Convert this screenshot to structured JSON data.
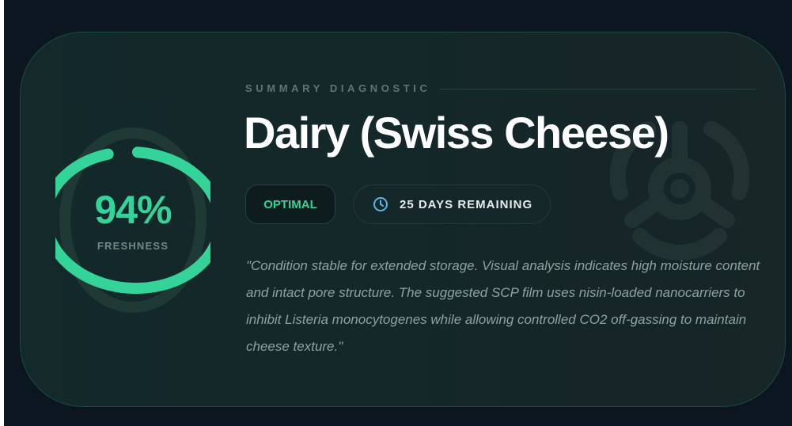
{
  "card": {
    "freshness": {
      "value": 0.94,
      "percent_label": "94%",
      "label": "FRESHNESS",
      "ring_color": "#34d399",
      "track_color": "#1f3a35"
    },
    "kicker": "SUMMARY DIAGNOSTIC",
    "title": "Dairy (Swiss Cheese)",
    "status_badge": "OPTIMAL",
    "remaining_badge": "25 DAYS REMAINING",
    "icons": {
      "clock": "clock-icon",
      "background": "biohazard-icon"
    },
    "description": "\"Condition stable for extended storage. Visual analysis indicates high moisture content and intact pore structure. The suggested SCP film uses nisin-loaded nanocarriers to inhibit Listeria monocytogenes while allowing controlled CO2 off-gassing to maintain cheese texture.\""
  },
  "colors": {
    "accent": "#34d399",
    "card_background": "#13292a",
    "page_background": "#0c1620"
  }
}
